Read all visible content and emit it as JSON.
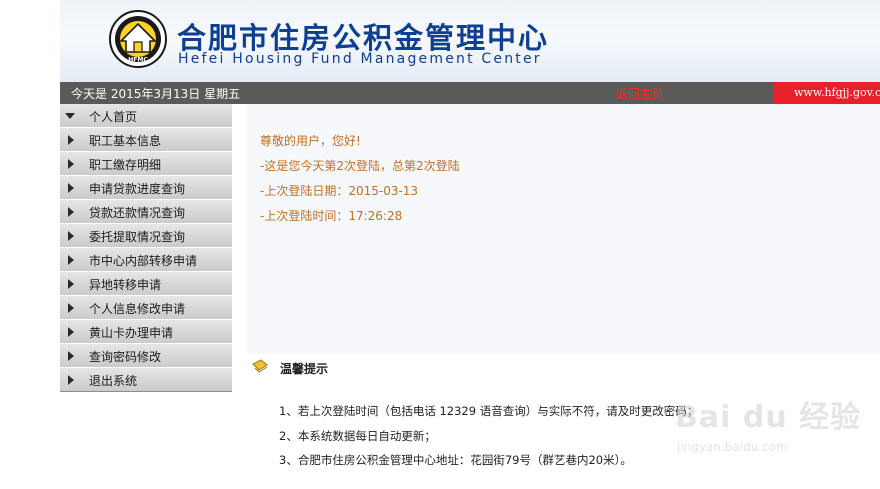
{
  "header": {
    "logo_text": "HFMC",
    "title_cn": "合肥市住房公积金管理中心",
    "title_en": "Hefei Housing Fund Management Center"
  },
  "datebar": {
    "date_text": "今天是  2015年3月13日  星期五",
    "home_link": "返回主页",
    "site_url": "www.hfgjj.gov.cn"
  },
  "menu": {
    "items": [
      {
        "label": "个人首页",
        "expanded": true
      },
      {
        "label": "职工基本信息"
      },
      {
        "label": "职工缴存明细"
      },
      {
        "label": "申请贷款进度查询"
      },
      {
        "label": "贷款还款情况查询"
      },
      {
        "label": "委托提取情况查询"
      },
      {
        "label": "市中心内部转移申请"
      },
      {
        "label": "异地转移申请"
      },
      {
        "label": "个人信息修改申请"
      },
      {
        "label": "黄山卡办理申请"
      },
      {
        "label": "查询密码修改"
      },
      {
        "label": "退出系统"
      }
    ]
  },
  "welcome": {
    "greeting": "尊敬的用户，您好!",
    "login_count": "-这是您今天第2次登陆，总第2次登陆",
    "last_login_date": "-上次登陆日期：2015-03-13",
    "last_login_time": "-上次登陆时间：17:26:28"
  },
  "tips": {
    "title": "温馨提示",
    "items": [
      "1、若上次登陆时间（包括电话 12329 语音查询）与实际不符，请及时更改密码；",
      "2、本系统数据每日自动更新；",
      "3、合肥市住房公积金管理中心地址：花园街79号（群艺巷内20米）。"
    ]
  },
  "watermark": {
    "main": "Bai du 经验",
    "sub": "jingyan.baidu.com"
  },
  "colors": {
    "title_blue": "#0e3f93",
    "welcome_orange": "#c07020",
    "home_link_red": "#ff2a2a",
    "site_box_red": "#e8202a",
    "datebar_gray": "#5a5a5a"
  }
}
